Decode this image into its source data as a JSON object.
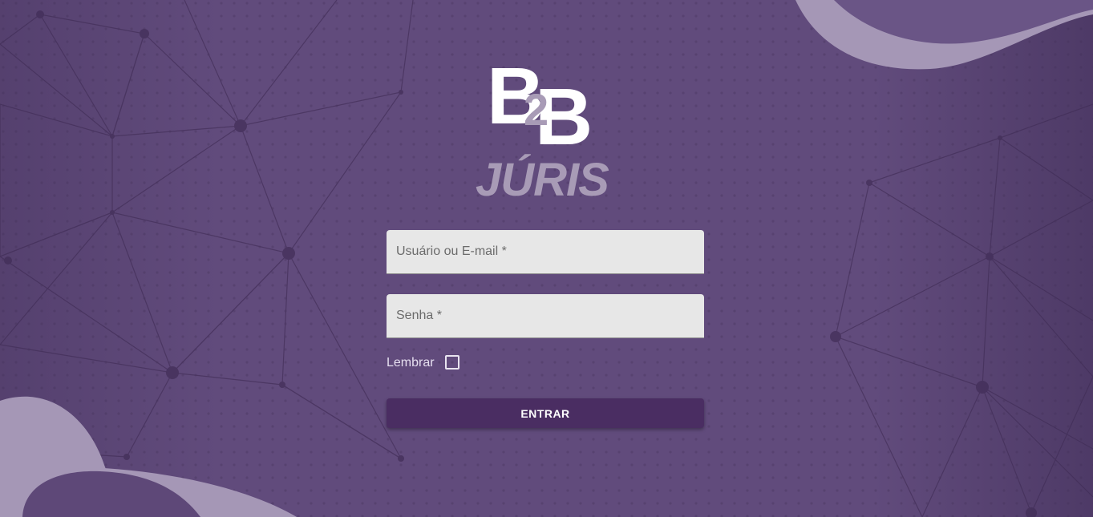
{
  "logo": {
    "mark_b1": "B",
    "mark_2": "2",
    "mark_b2": "B",
    "wordmark": "JÚRIS"
  },
  "form": {
    "username": {
      "label": "Usuário ou E-mail *",
      "value": ""
    },
    "password": {
      "label": "Senha *",
      "value": ""
    },
    "remember": {
      "label": "Lembrar",
      "checked": false
    },
    "submit_label": "ENTRAR"
  },
  "colors": {
    "background": "#614b7c",
    "button": "#4a2d62",
    "field": "#e7e7e7",
    "logo_white": "#ffffff",
    "logo_accent": "#a89bb6"
  }
}
